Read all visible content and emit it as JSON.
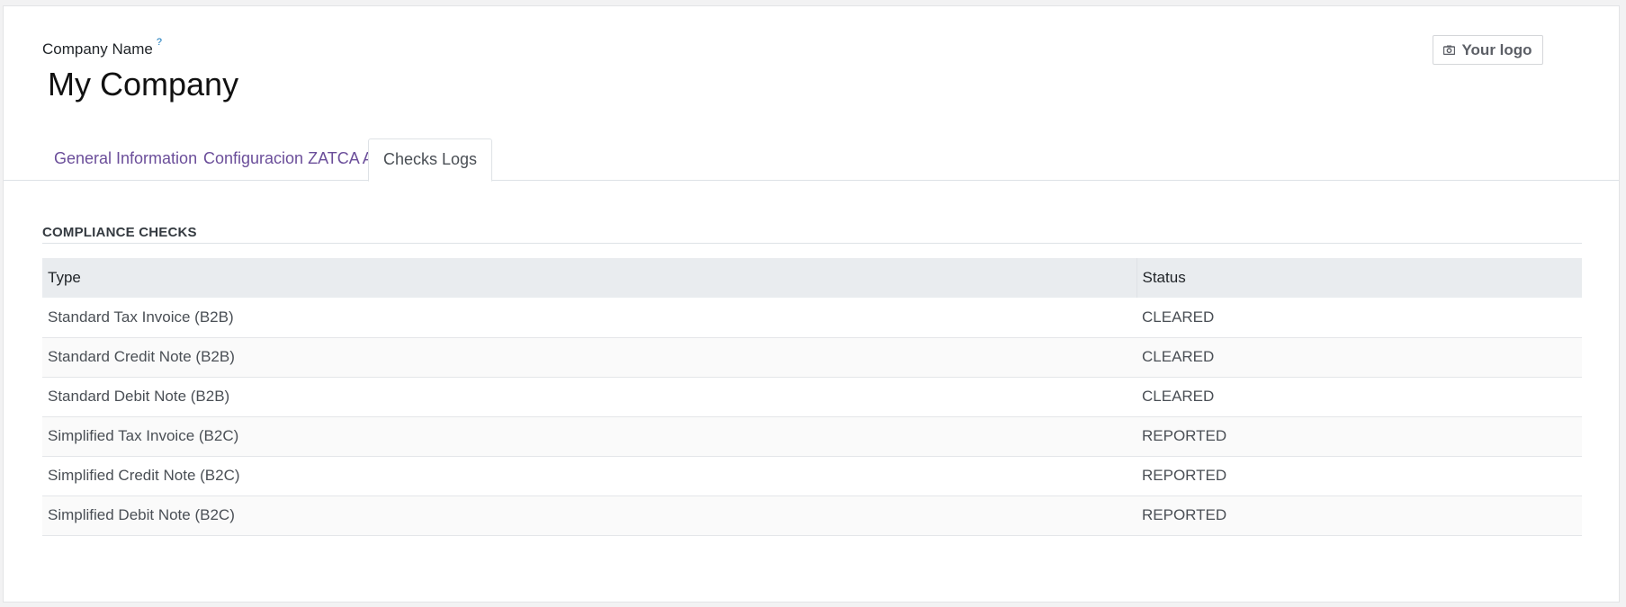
{
  "header": {
    "company_label": "Company Name",
    "help_marker": "?",
    "company_name": "My Company",
    "logo_button_label": "Your logo"
  },
  "tabs": [
    {
      "label": "General Information",
      "active": false
    },
    {
      "label": "Configuracion ZATCA API",
      "active": false
    },
    {
      "label": "Checks Logs",
      "active": true
    }
  ],
  "compliance": {
    "section_title": "COMPLIANCE CHECKS",
    "columns": [
      "Type",
      "Status"
    ],
    "rows": [
      {
        "type": "Standard Tax Invoice (B2B)",
        "status": "CLEARED"
      },
      {
        "type": "Standard Credit Note (B2B)",
        "status": "CLEARED"
      },
      {
        "type": "Standard Debit Note (B2B)",
        "status": "CLEARED"
      },
      {
        "type": "Simplified Tax Invoice (B2C)",
        "status": "REPORTED"
      },
      {
        "type": "Simplified Credit Note (B2C)",
        "status": "REPORTED"
      },
      {
        "type": "Simplified Debit Note (B2C)",
        "status": "REPORTED"
      }
    ]
  },
  "colors": {
    "tab_link": "#6b4e9a",
    "help_marker": "#0d73b8",
    "table_header_bg": "#e9ecef"
  },
  "icons": {
    "logo_button": "camera-icon"
  }
}
